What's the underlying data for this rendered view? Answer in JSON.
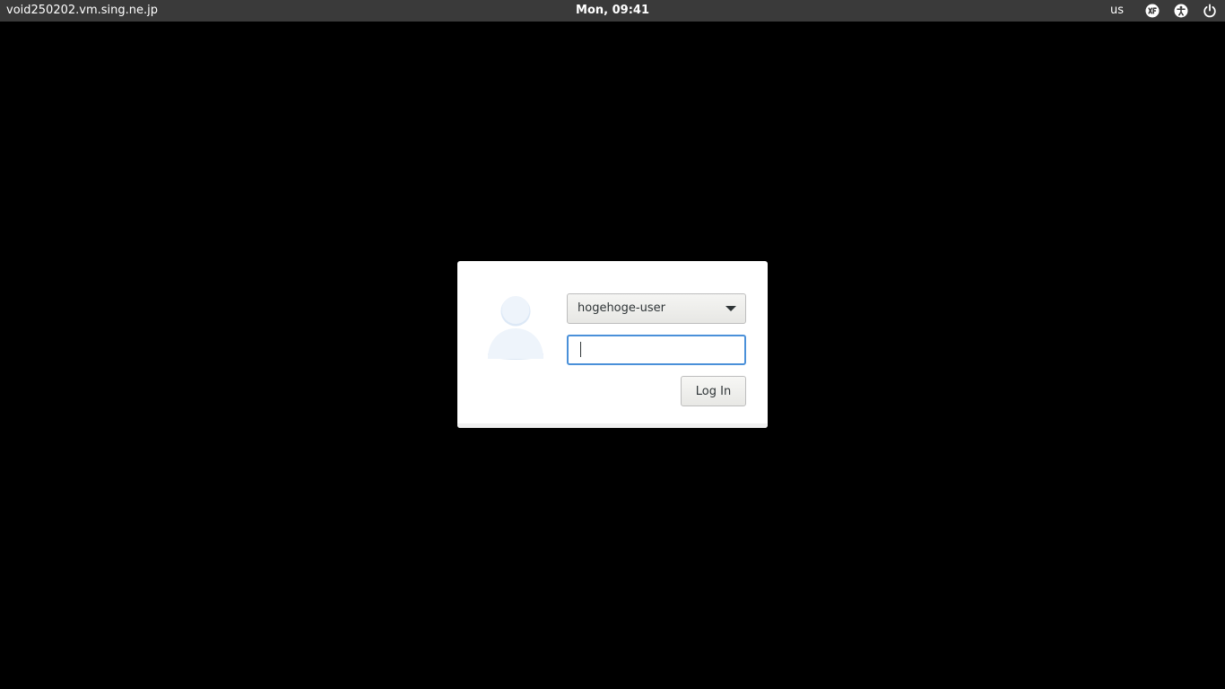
{
  "top_panel": {
    "hostname": "void250202.vm.sing.ne.jp",
    "clock": "Mon, 09:41",
    "keyboard_layout": "us",
    "indicators": [
      {
        "icon": "xfce-icon"
      },
      {
        "icon": "accessibility-icon"
      },
      {
        "icon": "power-icon"
      }
    ]
  },
  "login": {
    "avatar_icon": "user-avatar-icon",
    "selected_user": "hogehoge-user",
    "password_value": "",
    "login_button_label": "Log In",
    "focus_color": "#4a90d9"
  },
  "colors": {
    "background": "#000000",
    "panel": "#3a3a3a",
    "dialog": "#ffffff",
    "avatar": "#e8f0fa"
  }
}
